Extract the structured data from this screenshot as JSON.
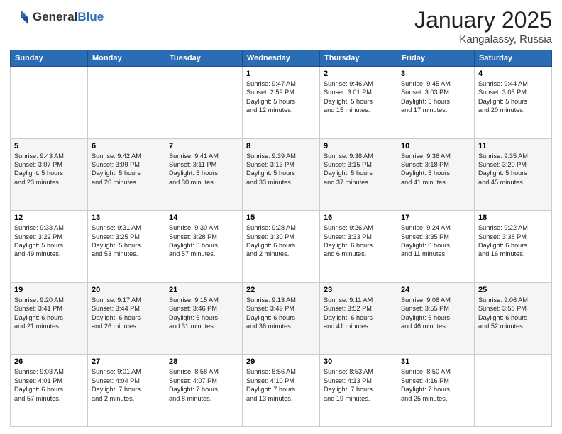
{
  "header": {
    "logo_general": "General",
    "logo_blue": "Blue",
    "month": "January 2025",
    "location": "Kangalassy, Russia"
  },
  "days_of_week": [
    "Sunday",
    "Monday",
    "Tuesday",
    "Wednesday",
    "Thursday",
    "Friday",
    "Saturday"
  ],
  "weeks": [
    [
      {
        "day": "",
        "info": ""
      },
      {
        "day": "",
        "info": ""
      },
      {
        "day": "",
        "info": ""
      },
      {
        "day": "1",
        "info": "Sunrise: 9:47 AM\nSunset: 2:59 PM\nDaylight: 5 hours\nand 12 minutes."
      },
      {
        "day": "2",
        "info": "Sunrise: 9:46 AM\nSunset: 3:01 PM\nDaylight: 5 hours\nand 15 minutes."
      },
      {
        "day": "3",
        "info": "Sunrise: 9:45 AM\nSunset: 3:03 PM\nDaylight: 5 hours\nand 17 minutes."
      },
      {
        "day": "4",
        "info": "Sunrise: 9:44 AM\nSunset: 3:05 PM\nDaylight: 5 hours\nand 20 minutes."
      }
    ],
    [
      {
        "day": "5",
        "info": "Sunrise: 9:43 AM\nSunset: 3:07 PM\nDaylight: 5 hours\nand 23 minutes."
      },
      {
        "day": "6",
        "info": "Sunrise: 9:42 AM\nSunset: 3:09 PM\nDaylight: 5 hours\nand 26 minutes."
      },
      {
        "day": "7",
        "info": "Sunrise: 9:41 AM\nSunset: 3:11 PM\nDaylight: 5 hours\nand 30 minutes."
      },
      {
        "day": "8",
        "info": "Sunrise: 9:39 AM\nSunset: 3:13 PM\nDaylight: 5 hours\nand 33 minutes."
      },
      {
        "day": "9",
        "info": "Sunrise: 9:38 AM\nSunset: 3:15 PM\nDaylight: 5 hours\nand 37 minutes."
      },
      {
        "day": "10",
        "info": "Sunrise: 9:36 AM\nSunset: 3:18 PM\nDaylight: 5 hours\nand 41 minutes."
      },
      {
        "day": "11",
        "info": "Sunrise: 9:35 AM\nSunset: 3:20 PM\nDaylight: 5 hours\nand 45 minutes."
      }
    ],
    [
      {
        "day": "12",
        "info": "Sunrise: 9:33 AM\nSunset: 3:22 PM\nDaylight: 5 hours\nand 49 minutes."
      },
      {
        "day": "13",
        "info": "Sunrise: 9:31 AM\nSunset: 3:25 PM\nDaylight: 5 hours\nand 53 minutes."
      },
      {
        "day": "14",
        "info": "Sunrise: 9:30 AM\nSunset: 3:28 PM\nDaylight: 5 hours\nand 57 minutes."
      },
      {
        "day": "15",
        "info": "Sunrise: 9:28 AM\nSunset: 3:30 PM\nDaylight: 6 hours\nand 2 minutes."
      },
      {
        "day": "16",
        "info": "Sunrise: 9:26 AM\nSunset: 3:33 PM\nDaylight: 6 hours\nand 6 minutes."
      },
      {
        "day": "17",
        "info": "Sunrise: 9:24 AM\nSunset: 3:35 PM\nDaylight: 6 hours\nand 11 minutes."
      },
      {
        "day": "18",
        "info": "Sunrise: 9:22 AM\nSunset: 3:38 PM\nDaylight: 6 hours\nand 16 minutes."
      }
    ],
    [
      {
        "day": "19",
        "info": "Sunrise: 9:20 AM\nSunset: 3:41 PM\nDaylight: 6 hours\nand 21 minutes."
      },
      {
        "day": "20",
        "info": "Sunrise: 9:17 AM\nSunset: 3:44 PM\nDaylight: 6 hours\nand 26 minutes."
      },
      {
        "day": "21",
        "info": "Sunrise: 9:15 AM\nSunset: 3:46 PM\nDaylight: 6 hours\nand 31 minutes."
      },
      {
        "day": "22",
        "info": "Sunrise: 9:13 AM\nSunset: 3:49 PM\nDaylight: 6 hours\nand 36 minutes."
      },
      {
        "day": "23",
        "info": "Sunrise: 9:11 AM\nSunset: 3:52 PM\nDaylight: 6 hours\nand 41 minutes."
      },
      {
        "day": "24",
        "info": "Sunrise: 9:08 AM\nSunset: 3:55 PM\nDaylight: 6 hours\nand 46 minutes."
      },
      {
        "day": "25",
        "info": "Sunrise: 9:06 AM\nSunset: 3:58 PM\nDaylight: 6 hours\nand 52 minutes."
      }
    ],
    [
      {
        "day": "26",
        "info": "Sunrise: 9:03 AM\nSunset: 4:01 PM\nDaylight: 6 hours\nand 57 minutes."
      },
      {
        "day": "27",
        "info": "Sunrise: 9:01 AM\nSunset: 4:04 PM\nDaylight: 7 hours\nand 2 minutes."
      },
      {
        "day": "28",
        "info": "Sunrise: 8:58 AM\nSunset: 4:07 PM\nDaylight: 7 hours\nand 8 minutes."
      },
      {
        "day": "29",
        "info": "Sunrise: 8:56 AM\nSunset: 4:10 PM\nDaylight: 7 hours\nand 13 minutes."
      },
      {
        "day": "30",
        "info": "Sunrise: 8:53 AM\nSunset: 4:13 PM\nDaylight: 7 hours\nand 19 minutes."
      },
      {
        "day": "31",
        "info": "Sunrise: 8:50 AM\nSunset: 4:16 PM\nDaylight: 7 hours\nand 25 minutes."
      },
      {
        "day": "",
        "info": ""
      }
    ]
  ]
}
